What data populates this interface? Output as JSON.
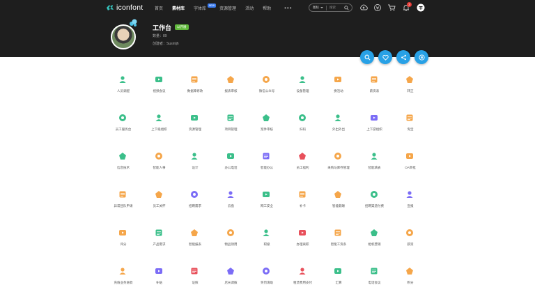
{
  "header": {
    "logo_text": "iconfont",
    "nav": [
      "首页",
      "素材库",
      "字体库",
      "资源管理",
      "活动",
      "帮助"
    ],
    "nav_badge": "NEW",
    "more": "•••",
    "search_type": "图标",
    "search_placeholder": "搜索",
    "notification_count": "3"
  },
  "workspace": {
    "title": "工作台",
    "badge": "以开展",
    "count_label": "数量：89",
    "creator_label": "创建者：Susinljh"
  },
  "icons": [
    {
      "label": "人员调配",
      "icon": "person-icon",
      "color": "#3bbf8a"
    },
    {
      "label": "视频会议",
      "icon": "video-icon",
      "color": "#3bbf8a"
    },
    {
      "label": "数据库修改",
      "icon": "database-icon",
      "color": "#f5a64a"
    },
    {
      "label": "报表审核",
      "icon": "report-icon",
      "color": "#f5a64a"
    },
    {
      "label": "微信公众号",
      "icon": "wechat-icon",
      "color": "#f5a64a"
    },
    {
      "label": "设备管理",
      "icon": "device-icon",
      "color": "#3bbf8a"
    },
    {
      "label": "换活动",
      "icon": "flag-icon",
      "color": "#f5a64a"
    },
    {
      "label": "薪资表",
      "icon": "chart-icon",
      "color": "#f5a64a"
    },
    {
      "label": "转正",
      "icon": "user-check-icon",
      "color": "#f5a64a"
    },
    {
      "label": "员工服务台",
      "icon": "service-icon",
      "color": "#3bbf8a"
    },
    {
      "label": "上下级组织",
      "icon": "org-icon",
      "color": "#3bbf8a"
    },
    {
      "label": "资源管理",
      "icon": "bookmark-icon",
      "color": "#3bbf8a"
    },
    {
      "label": "项目管理",
      "icon": "folder-icon",
      "color": "#3bbf8a"
    },
    {
      "label": "案件审核",
      "icon": "case-icon",
      "color": "#3bbf8a"
    },
    {
      "label": "扫码",
      "icon": "scan-icon",
      "color": "#3bbf8a"
    },
    {
      "label": "外出外出",
      "icon": "out-icon",
      "color": "#3bbf8a"
    },
    {
      "label": "上下游组织",
      "icon": "link-icon",
      "color": "#7b6cf6"
    },
    {
      "label": "淘宝",
      "icon": "taobao-icon",
      "color": "#f5a64a"
    },
    {
      "label": "信息技术",
      "icon": "monitor-icon",
      "color": "#3bbf8a"
    },
    {
      "label": "智能人事",
      "icon": "hr-icon",
      "color": "#f5a64a"
    },
    {
      "label": "设计",
      "icon": "design-icon",
      "color": "#3bbf8a"
    },
    {
      "label": "办公电话",
      "icon": "phone-icon",
      "color": "#3bbf8a"
    },
    {
      "label": "智能办公",
      "icon": "robot-icon",
      "color": "#7b6cf6"
    },
    {
      "label": "员工福利",
      "icon": "gift-icon",
      "color": "#e8505b"
    },
    {
      "label": "采购与库存管理",
      "icon": "warehouse-icon",
      "color": "#f5a64a"
    },
    {
      "label": "智能填表",
      "icon": "form-icon",
      "color": "#3bbf8a"
    },
    {
      "label": "OA审批",
      "icon": "approve-icon",
      "color": "#f5a64a"
    },
    {
      "label": "异常团队申请",
      "icon": "alert-icon",
      "color": "#f5a64a"
    },
    {
      "label": "员工关怀",
      "icon": "clock-icon",
      "color": "#f5a64a"
    },
    {
      "label": "招聘需求",
      "icon": "recruit-icon",
      "color": "#7b6cf6"
    },
    {
      "label": "云盘",
      "icon": "cloud-icon",
      "color": "#7b6cf6"
    },
    {
      "label": "网工安全",
      "icon": "shield-icon",
      "color": "#3bbf8a"
    },
    {
      "label": "补卡",
      "icon": "card-icon",
      "color": "#f5a64a"
    },
    {
      "label": "智能薪酬",
      "icon": "salary-icon",
      "color": "#f5a64a"
    },
    {
      "label": "招聘渠道付费",
      "icon": "pay-icon",
      "color": "#3bbf8a"
    },
    {
      "label": "宣报",
      "icon": "box-icon",
      "color": "#7b6cf6"
    },
    {
      "label": "评分",
      "icon": "score-icon",
      "color": "#f5a64a"
    },
    {
      "label": "产品需求",
      "icon": "cube-icon",
      "color": "#3bbf8a"
    },
    {
      "label": "智能报表",
      "icon": "trend-icon",
      "color": "#f5a64a"
    },
    {
      "label": "物品领用",
      "icon": "goods-icon",
      "color": "#f5a64a"
    },
    {
      "label": "职级",
      "icon": "level-icon",
      "color": "#3bbf8a"
    },
    {
      "label": "办理离职",
      "icon": "leave-icon",
      "color": "#e8505b"
    },
    {
      "label": "智能工资条",
      "icon": "slip-icon",
      "color": "#f5a64a"
    },
    {
      "label": "相机营销",
      "icon": "chat-icon",
      "color": "#3bbf8a"
    },
    {
      "label": "薪资",
      "icon": "wallet-icon",
      "color": "#f5a64a"
    },
    {
      "label": "充值业务进款",
      "icon": "recharge-icon",
      "color": "#f5a64a"
    },
    {
      "label": "补贴",
      "icon": "subsidy-icon",
      "color": "#7b6cf6"
    },
    {
      "label": "证照",
      "icon": "license-icon",
      "color": "#e8505b"
    },
    {
      "label": "店长调拨",
      "icon": "manager-icon",
      "color": "#7b6cf6"
    },
    {
      "label": "奖罚请助",
      "icon": "store-icon",
      "color": "#7b6cf6"
    },
    {
      "label": "租赁费用支付",
      "icon": "rent-icon",
      "color": "#e8505b"
    },
    {
      "label": "汇算",
      "icon": "calc-icon",
      "color": "#3bbf8a"
    },
    {
      "label": "电话会议",
      "icon": "conference-icon",
      "color": "#3bbf8a"
    },
    {
      "label": "积分",
      "icon": "points-icon",
      "color": "#f5a64a"
    }
  ]
}
